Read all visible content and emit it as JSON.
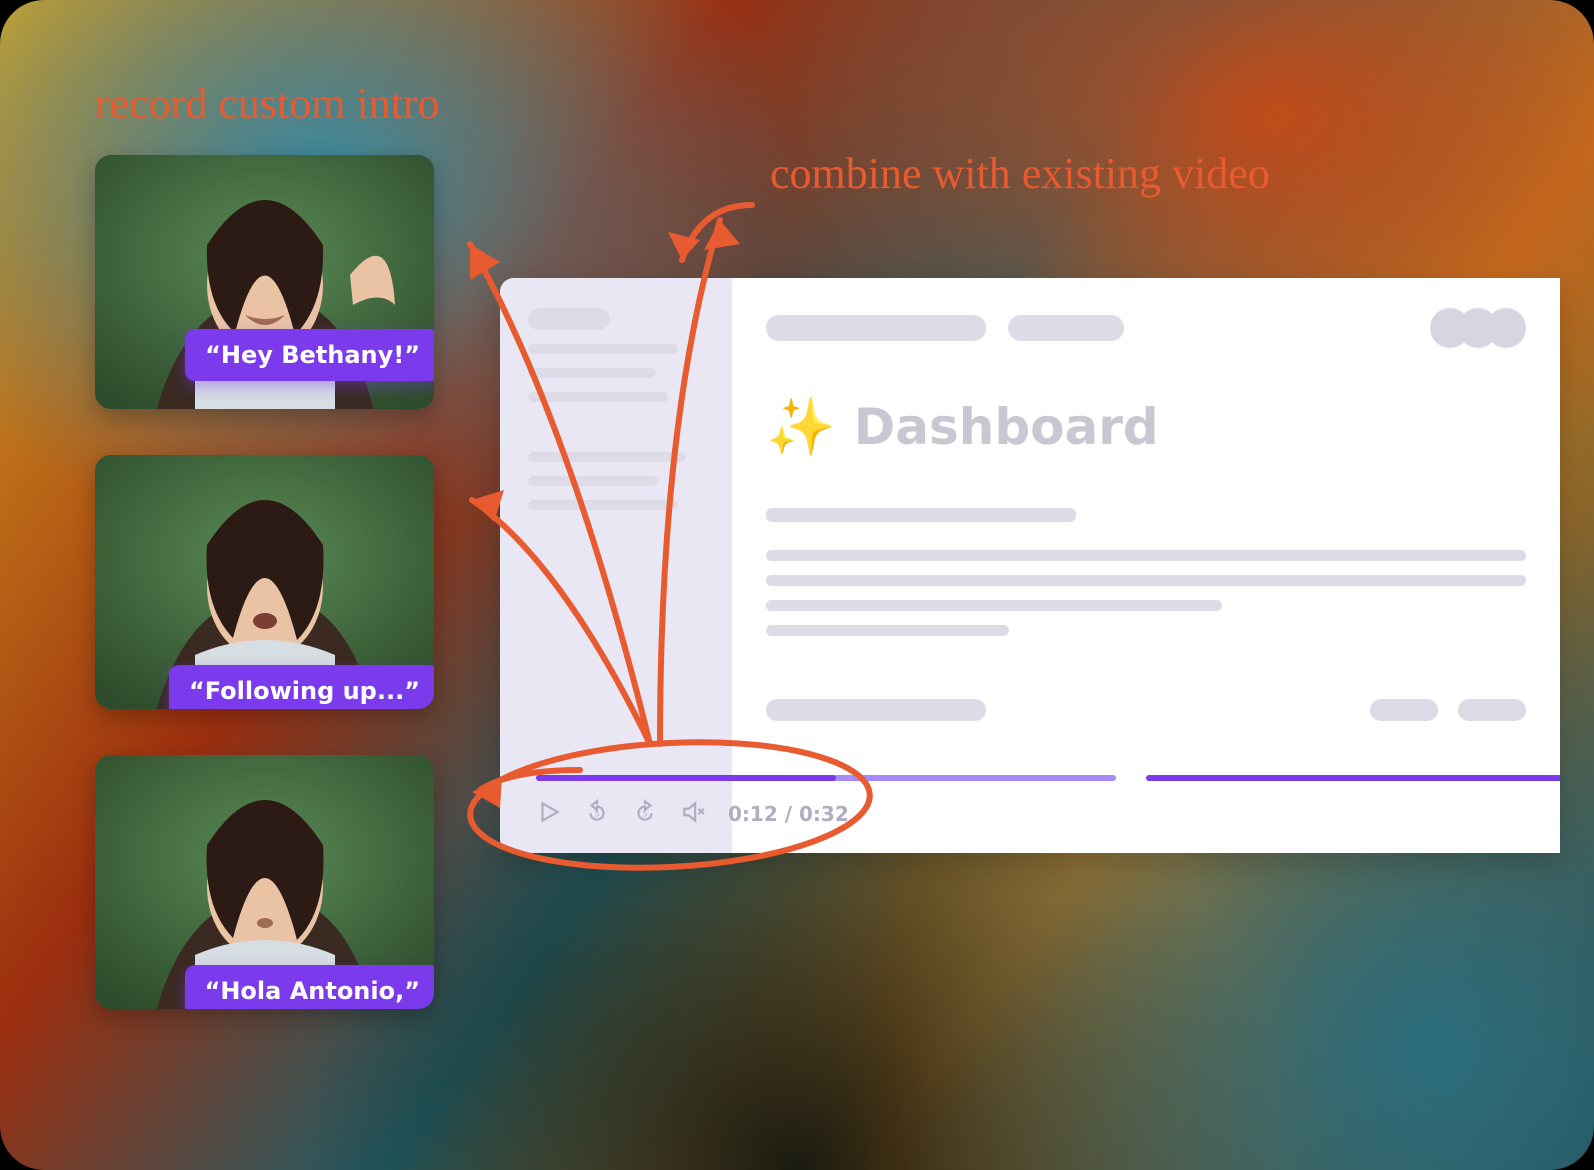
{
  "annotations": {
    "left": "record custom intro",
    "right": "combine with existing video"
  },
  "thumbs": [
    {
      "caption": "“Hey Bethany!”"
    },
    {
      "caption": "“Following up...”"
    },
    {
      "caption": "“Hola Antonio,”"
    }
  ],
  "dashboard": {
    "emoji": "✨",
    "title": "Dashboard"
  },
  "player_controls": {
    "play": "play",
    "back5": "back 5s",
    "fwd5": "forward 5s",
    "mute": "muted",
    "current": "0:12",
    "sep": " / ",
    "total": "0:32"
  }
}
